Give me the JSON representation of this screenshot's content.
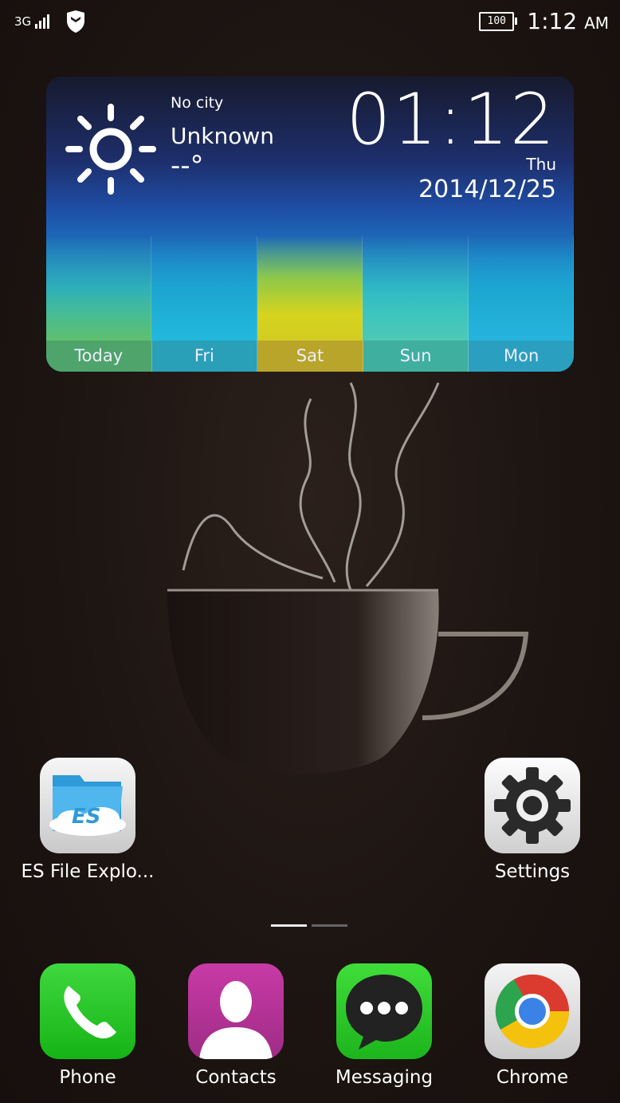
{
  "status": {
    "network": "3G",
    "battery": "100",
    "time": "1:12",
    "ampm": "AM"
  },
  "weather": {
    "city": "No city",
    "condition": "Unknown",
    "temperature": "--°",
    "time": "01:12",
    "day": "Thu",
    "date": "2014/12/25",
    "forecast": [
      "Today",
      "Fri",
      "Sat",
      "Sun",
      "Mon"
    ]
  },
  "apps": {
    "es_file": "ES File Explo...",
    "settings": "Settings"
  },
  "dock": {
    "phone": "Phone",
    "contacts": "Contacts",
    "messaging": "Messaging",
    "chrome": "Chrome"
  },
  "pages": {
    "count": 2,
    "active": 1
  }
}
